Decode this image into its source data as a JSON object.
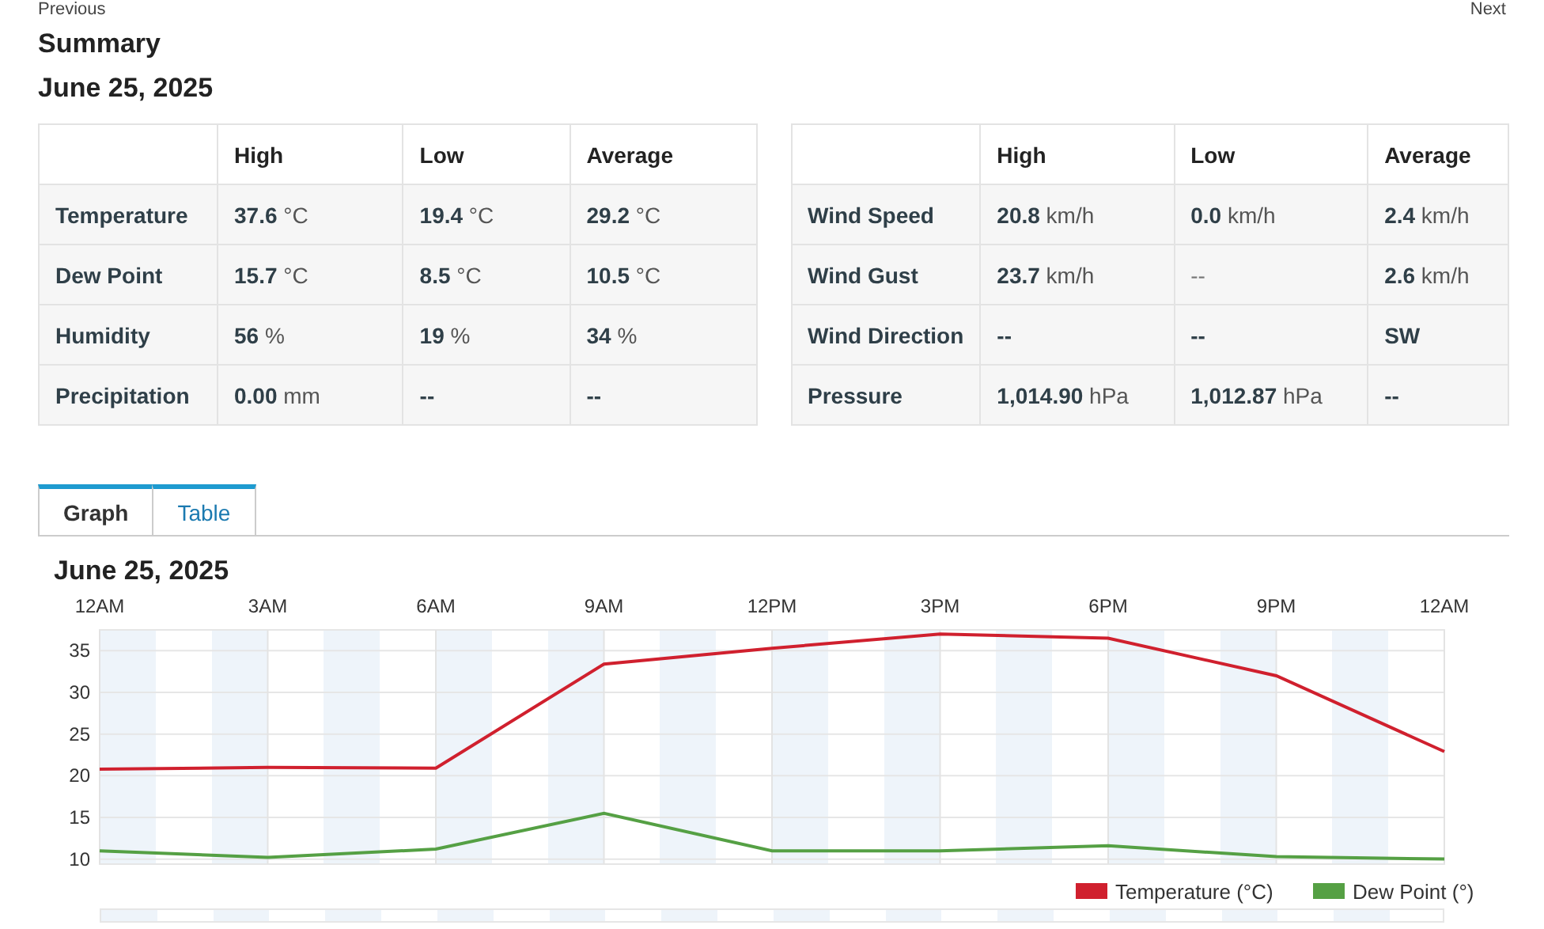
{
  "nav": {
    "previous": "Previous",
    "next": "Next"
  },
  "summary": {
    "title": "Summary",
    "date": "June 25, 2025"
  },
  "tables": [
    {
      "columns": [
        "High",
        "Low",
        "Average"
      ],
      "rows": [
        {
          "label": "Temperature",
          "cells": [
            {
              "value": "37.6",
              "unit": "°C"
            },
            {
              "value": "19.4",
              "unit": "°C"
            },
            {
              "value": "29.2",
              "unit": "°C"
            }
          ]
        },
        {
          "label": "Dew Point",
          "cells": [
            {
              "value": "15.7",
              "unit": "°C"
            },
            {
              "value": "8.5",
              "unit": "°C"
            },
            {
              "value": "10.5",
              "unit": "°C"
            }
          ]
        },
        {
          "label": "Humidity",
          "cells": [
            {
              "value": "56",
              "unit": "%"
            },
            {
              "value": "19",
              "unit": "%"
            },
            {
              "value": "34",
              "unit": "%"
            }
          ]
        },
        {
          "label": "Precipitation",
          "cells": [
            {
              "value": "0.00",
              "unit": "mm"
            },
            {
              "value": "--"
            },
            {
              "value": "--"
            }
          ]
        }
      ]
    },
    {
      "columns": [
        "High",
        "Low",
        "Average"
      ],
      "rows": [
        {
          "label": "Wind Speed",
          "cells": [
            {
              "value": "20.8",
              "unit": "km/h"
            },
            {
              "value": "0.0",
              "unit": "km/h"
            },
            {
              "value": "2.4",
              "unit": "km/h"
            }
          ]
        },
        {
          "label": "Wind Gust",
          "cells": [
            {
              "value": "23.7",
              "unit": "km/h"
            },
            {
              "value": "--",
              "muted": true
            },
            {
              "value": "2.6",
              "unit": "km/h"
            }
          ]
        },
        {
          "label": "Wind Direction",
          "cells": [
            {
              "value": "--"
            },
            {
              "value": "--"
            },
            {
              "value": "SW"
            }
          ]
        },
        {
          "label": "Pressure",
          "cells": [
            {
              "value": "1,014.90",
              "unit": "hPa"
            },
            {
              "value": "1,012.87",
              "unit": "hPa"
            },
            {
              "value": "--"
            }
          ]
        }
      ]
    }
  ],
  "tabs": [
    {
      "label": "Graph",
      "selected": true
    },
    {
      "label": "Table",
      "selected": false
    }
  ],
  "chart_title": "June 25, 2025",
  "chart_data": {
    "type": "line",
    "categories": [
      "12AM",
      "3AM",
      "6AM",
      "9AM",
      "12PM",
      "3PM",
      "6PM",
      "9PM",
      "12AM"
    ],
    "yticks": [
      10,
      15,
      20,
      25,
      30,
      35
    ],
    "ylim": [
      9.4,
      37.5
    ],
    "grid": true,
    "legend": true,
    "series": [
      {
        "name": "Temperature (°C)",
        "color": "#d0202e",
        "values": [
          20.8,
          21,
          20.9,
          33.4,
          35.3,
          37,
          36.5,
          32,
          22.9
        ]
      },
      {
        "name": "Dew Point (°)",
        "color": "#55a044",
        "values": [
          11,
          10.2,
          11.2,
          15.5,
          11,
          11,
          11.6,
          10.3,
          10
        ]
      }
    ]
  }
}
